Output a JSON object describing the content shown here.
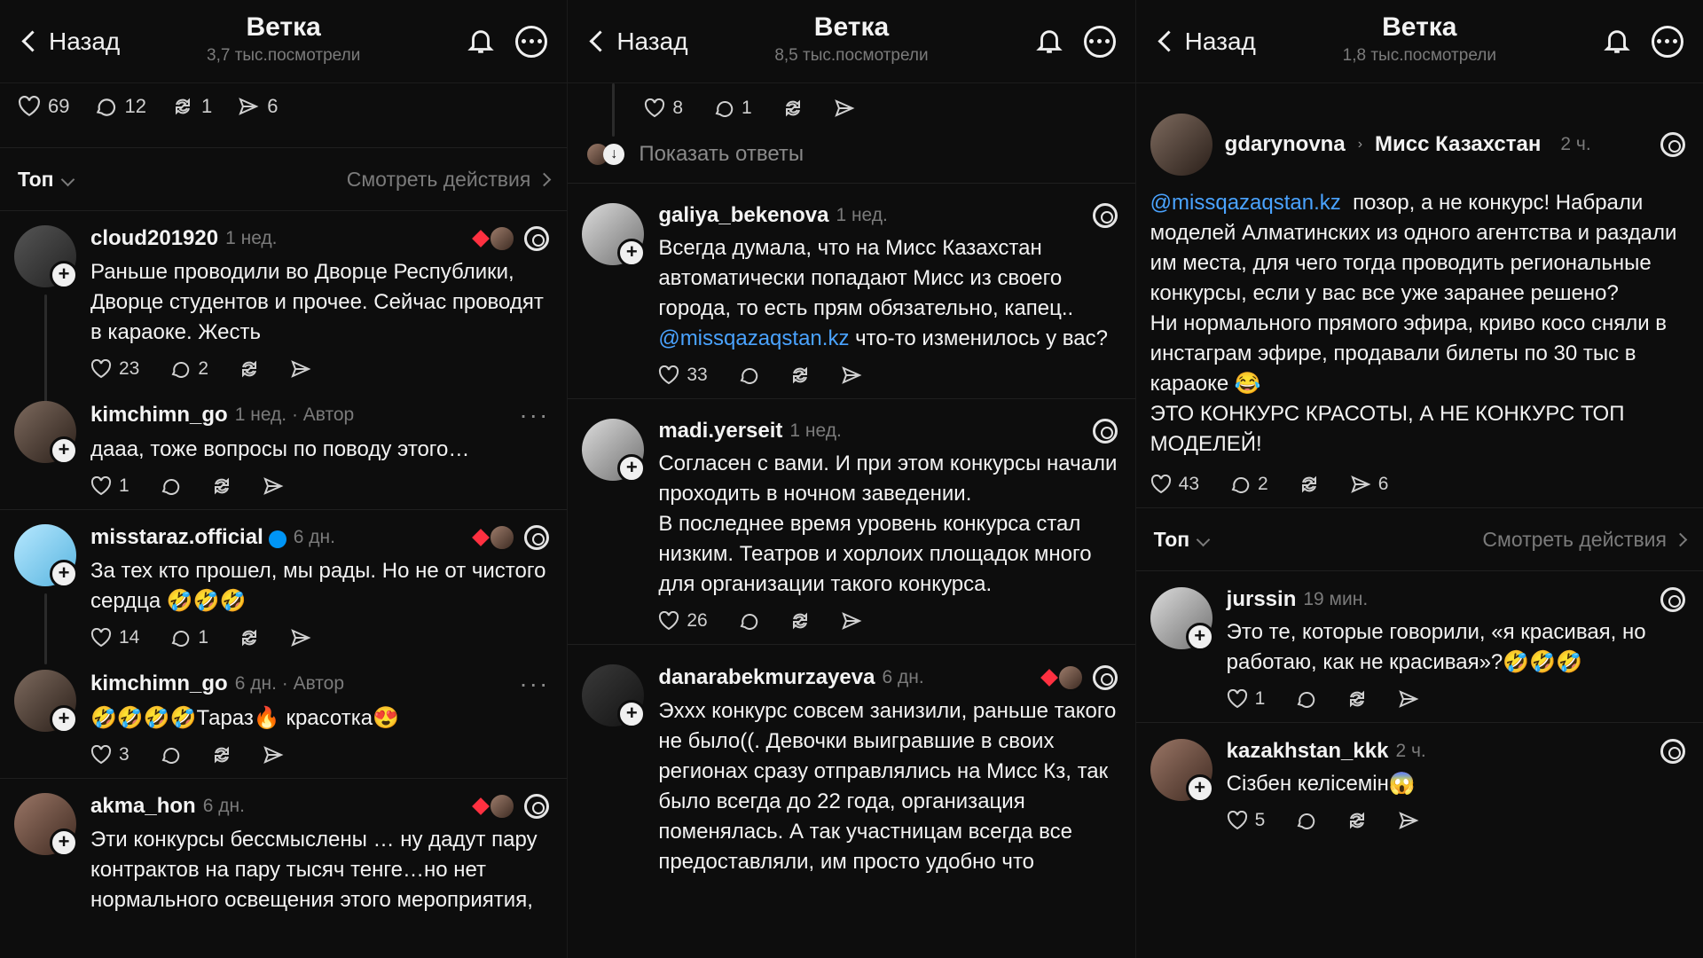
{
  "header": {
    "back": "Назад",
    "title": "Ветка"
  },
  "panels": [
    {
      "views": "3,7 тыс.посмотрели",
      "stats": {
        "likes": "69",
        "replies": "12",
        "reposts": "1",
        "shares": "6"
      },
      "top_label": "Топ",
      "actions_label": "Смотреть действия",
      "comments": [
        {
          "user": "cloud201920",
          "time": "1 нед.",
          "text": "Раньше проводили во Дворце Республики, Дворце студентов и прочее. Сейчас проводят в караоке. Жесть",
          "likes": "23",
          "replies": "2"
        },
        {
          "user": "kimchimn_go",
          "time": "1 нед. · Автор",
          "text": "дааа, тоже вопросы по поводу этого…",
          "likes": "1"
        },
        {
          "user": "misstaraz.official",
          "time": "6 дн.",
          "text": "За тех кто прошел, мы рады. Но не от чистого сердца 🤣🤣🤣",
          "likes": "14",
          "replies": "1"
        },
        {
          "user": "kimchimn_go",
          "time": "6 дн. · Автор",
          "text": "🤣🤣🤣🤣Тараз🔥 красотка😍",
          "likes": "3"
        },
        {
          "user": "akma_hon",
          "time": "6 дн.",
          "text": "Эти конкурсы бессмыслены … ну дадут пару контрактов на пару тысяч тенге…но нет нормального освещения этого мероприятия,"
        }
      ]
    },
    {
      "views": "8,5 тыс.посмотрели",
      "prev_stats": {
        "likes": "8",
        "replies": "1"
      },
      "show_replies": "Показать ответы",
      "comments": [
        {
          "user": "galiya_bekenova",
          "time": "1 нед.",
          "text_before_link": "Всегда думала, что на Мисс Казахстан автоматически попадают Мисс из своего города, то есть прям обязательно, капец..",
          "link": "@missqazaqstan.kz",
          "text_after_link": " что-то изменилось у вас?",
          "likes": "33"
        },
        {
          "user": "madi.yerseit",
          "time": "1 нед.",
          "text": "Согласен с вами. И при этом конкурсы начали проходить в ночном заведении.\nВ последнее время уровень конкурса стал низким. Театров и хорлоих площадок много для организации такого конкурса.",
          "likes": "26"
        },
        {
          "user": "danarabekmurzayeva",
          "time": "6 дн.",
          "text": "Эххх конкурс совсем занизили, раньше такого не было((. Девочки выигравшие в своих регионах сразу отправлялись на Мисс Кз, так было всегда до 22 года, организация поменялась. А так участницам всегда все предоставляли, им просто удобно что"
        }
      ]
    },
    {
      "views": "1,8 тыс.посмотрели",
      "post": {
        "user": "gdarynovna",
        "community": "Мисс Казахстан",
        "time": "2 ч.",
        "link": "@missqazaqstan.kz",
        "text_after_link": "  позор, а не конкурс! Набрали моделей Алматинских из одного агентства и раздали им места, для чего тогда проводить региональные конкурсы, если у вас все уже заранее решено?\nНи нормального прямого эфира, криво косо сняли в инстаграм эфире, продавали билеты по 30 тыс в караоке 😂\nЭТО КОНКУРС КРАСОТЫ, А НЕ КОНКУРС ТОП МОДЕЛЕЙ!",
        "likes": "43",
        "replies": "2",
        "shares": "6"
      },
      "top_label": "Топ",
      "actions_label": "Смотреть действия",
      "comments": [
        {
          "user": "jurssin",
          "time": "19 мин.",
          "text": "Это те, которые говорили, «я красивая, но работаю, как не красивая»?🤣🤣🤣",
          "likes": "1"
        },
        {
          "user": "kazakhstan_kkk",
          "time": "2 ч.",
          "text": "Сізбен келісемін😱",
          "likes": "5"
        }
      ]
    }
  ],
  "colors": {
    "background": "#0d0d0d",
    "link": "#4aa3ff",
    "muted": "#7b7b7b",
    "heart": "#ff3040",
    "verified": "#0095f6"
  }
}
